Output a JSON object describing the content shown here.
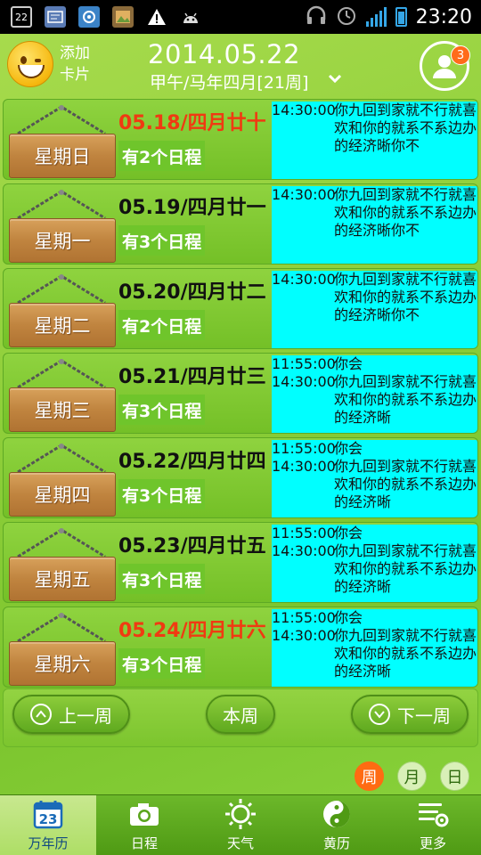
{
  "status_bar": {
    "time": "23:20",
    "icons": [
      "calendar-22-icon",
      "card-icon",
      "app-icon",
      "photo-icon",
      "warning-icon",
      "android-icon",
      "headphones-icon",
      "alarm-icon",
      "signal-e-icon",
      "battery-icon"
    ],
    "calendar_day": "22"
  },
  "header": {
    "add_card_label": "添加\n卡片",
    "date_main": "2014.05.22",
    "date_sub": "甲午/马年四月[21周]",
    "profile_badge": "3"
  },
  "days": [
    {
      "weekday": "星期日",
      "date": "05.18/四月廿十",
      "is_weekend": true,
      "count_label": "有2个日程",
      "events": [
        {
          "time": "14:30:00",
          "text": "你九回到家就不行就喜欢和你的就系不系边办的经济晰你不"
        }
      ]
    },
    {
      "weekday": "星期一",
      "date": "05.19/四月廿一",
      "is_weekend": false,
      "count_label": "有3个日程",
      "events": [
        {
          "time": "14:30:00",
          "text": "你九回到家就不行就喜欢和你的就系不系边办的经济晰你不"
        }
      ]
    },
    {
      "weekday": "星期二",
      "date": "05.20/四月廿二",
      "is_weekend": false,
      "count_label": "有2个日程",
      "events": [
        {
          "time": "14:30:00",
          "text": "你九回到家就不行就喜欢和你的就系不系边办的经济晰你不"
        }
      ]
    },
    {
      "weekday": "星期三",
      "date": "05.21/四月廿三",
      "is_weekend": false,
      "count_label": "有3个日程",
      "events": [
        {
          "time": "11:55:00",
          "text": "你会"
        },
        {
          "time": "14:30:00",
          "text": "你九回到家就不行就喜欢和你的就系不系边办的经济晰"
        }
      ]
    },
    {
      "weekday": "星期四",
      "date": "05.22/四月廿四",
      "is_weekend": false,
      "count_label": "有3个日程",
      "events": [
        {
          "time": "11:55:00",
          "text": "你会"
        },
        {
          "time": "14:30:00",
          "text": "你九回到家就不行就喜欢和你的就系不系边办的经济晰"
        }
      ]
    },
    {
      "weekday": "星期五",
      "date": "05.23/四月廿五",
      "is_weekend": false,
      "count_label": "有3个日程",
      "events": [
        {
          "time": "11:55:00",
          "text": "你会"
        },
        {
          "time": "14:30:00",
          "text": "你九回到家就不行就喜欢和你的就系不系边办的经济晰"
        }
      ]
    },
    {
      "weekday": "星期六",
      "date": "05.24/四月廿六",
      "is_weekend": true,
      "count_label": "有3个日程",
      "events": [
        {
          "time": "11:55:00",
          "text": "你会"
        },
        {
          "time": "14:30:00",
          "text": "你九回到家就不行就喜欢和你的就系不系边办的经济晰"
        }
      ]
    }
  ],
  "week_nav": {
    "prev_label": "上一周",
    "current_label": "本周",
    "next_label": "下一周"
  },
  "view_toggles": [
    {
      "label": "周",
      "active": true
    },
    {
      "label": "月",
      "active": false
    },
    {
      "label": "日",
      "active": false
    }
  ],
  "bottom_nav": [
    {
      "label": "万年历",
      "icon": "calendar-icon",
      "icon_text": "23",
      "active": true
    },
    {
      "label": "日程",
      "icon": "camera-icon",
      "active": false
    },
    {
      "label": "天气",
      "icon": "sun-icon",
      "active": false
    },
    {
      "label": "黄历",
      "icon": "yin-yang-icon",
      "active": false
    },
    {
      "label": "更多",
      "icon": "more-settings-icon",
      "active": false
    }
  ],
  "colors": {
    "weekend_date": "#f03a12",
    "schedule_bg": "#00ffff",
    "active_toggle": "#ff6b12",
    "badge": "#ff6b1a"
  }
}
